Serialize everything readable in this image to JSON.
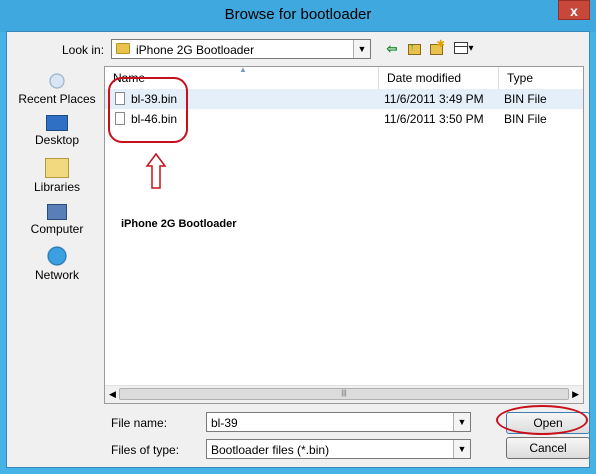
{
  "window": {
    "title": "Browse for bootloader",
    "close_glyph": "x"
  },
  "lookin": {
    "label": "Look in:",
    "value": "iPhone 2G Bootloader"
  },
  "places": [
    {
      "label": "Recent Places",
      "icon": "recent-places-icon"
    },
    {
      "label": "Desktop",
      "icon": "desktop-icon"
    },
    {
      "label": "Libraries",
      "icon": "libraries-icon"
    },
    {
      "label": "Computer",
      "icon": "computer-icon"
    },
    {
      "label": "Network",
      "icon": "network-icon"
    }
  ],
  "columns": {
    "name": "Name",
    "date": "Date modified",
    "type": "Type"
  },
  "files": [
    {
      "name": "bl-39.bin",
      "date": "11/6/2011 3:49 PM",
      "type": "BIN File"
    },
    {
      "name": "bl-46.bin",
      "date": "11/6/2011 3:50 PM",
      "type": "BIN File"
    }
  ],
  "annotation": {
    "text": "iPhone 2G Bootloader",
    "color": "#c8101a"
  },
  "filename": {
    "label": "File name:",
    "value": "bl-39"
  },
  "filetype": {
    "label": "Files of type:",
    "value": "Bootloader files (*.bin)"
  },
  "buttons": {
    "open": "Open",
    "cancel": "Cancel"
  }
}
